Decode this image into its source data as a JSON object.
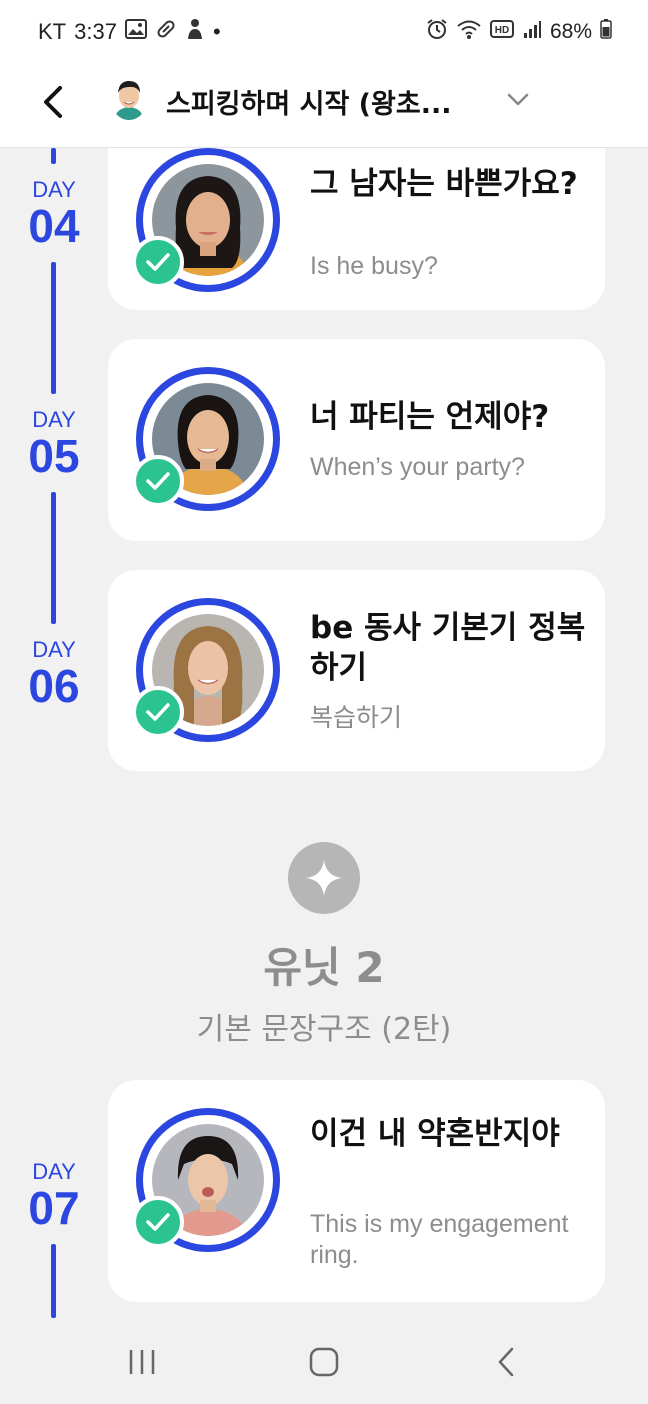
{
  "status_bar": {
    "carrier": "KT",
    "time": "3:37",
    "dot": "•",
    "battery": "68%",
    "left_icons": [
      "gallery-icon",
      "pill-icon",
      "person-icon"
    ],
    "right_icons": [
      "alarm-icon",
      "wifi-icon",
      "hd-icon",
      "signal-icon",
      "battery-icon"
    ]
  },
  "header": {
    "title": "스피킹하며 시작 (왕초...",
    "back_icon": "chevron-left-icon",
    "dropdown_icon": "chevron-down-icon"
  },
  "colors": {
    "accent": "#2b47e0",
    "check": "#2bc38f",
    "muted_text": "#8d8d8d",
    "background": "#f1f1f1",
    "card": "#ffffff"
  },
  "lessons": [
    {
      "day_word": "DAY",
      "day_num": "04",
      "title": "그 남자는 바쁜가요?",
      "subtitle": "Is he busy?",
      "completed": true
    },
    {
      "day_word": "DAY",
      "day_num": "05",
      "title": "너 파티는 언제야?",
      "subtitle": "When’s your party?",
      "completed": true
    },
    {
      "day_word": "DAY",
      "day_num": "06",
      "title": "be 동사 기본기 정복하기",
      "subtitle": "복습하기",
      "completed": true
    },
    {
      "day_word": "DAY",
      "day_num": "07",
      "title": "이건 내 약혼반지야",
      "subtitle": "This is my engagement ring.",
      "completed": true
    }
  ],
  "unit": {
    "title": "유닛 2",
    "subtitle": "기본 문장구조 (2탄)",
    "icon": "sparkle-icon"
  },
  "nav_bar": {
    "icons": [
      "recent-apps-icon",
      "home-icon",
      "back-icon"
    ]
  }
}
